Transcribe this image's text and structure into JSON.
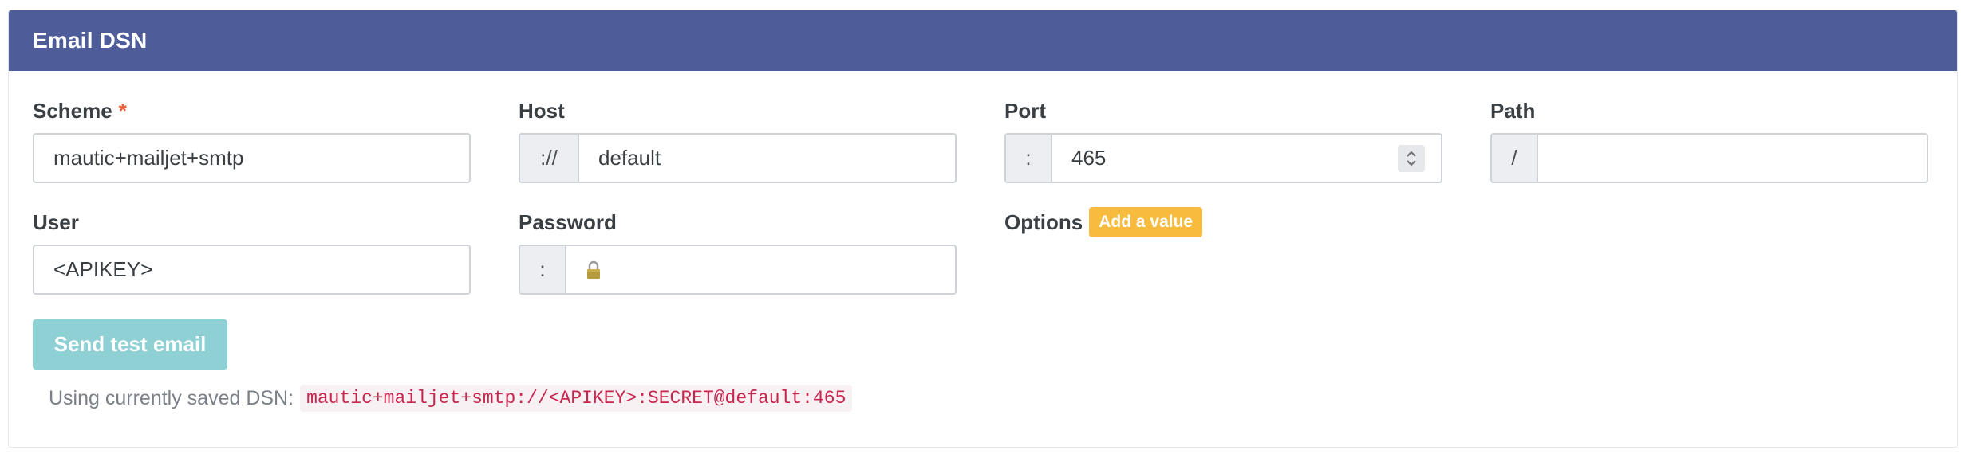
{
  "panel": {
    "title": "Email DSN"
  },
  "fields": {
    "scheme": {
      "label": "Scheme",
      "required_mark": "*",
      "value": "mautic+mailjet+smtp"
    },
    "host": {
      "label": "Host",
      "prefix": "://",
      "value": "default"
    },
    "port": {
      "label": "Port",
      "prefix": ":",
      "value": "465"
    },
    "path": {
      "label": "Path",
      "prefix": "/",
      "value": ""
    },
    "user": {
      "label": "User",
      "value": "<APIKEY>"
    },
    "password": {
      "label": "Password",
      "prefix": ":",
      "icon": "lock-icon"
    },
    "options": {
      "label": "Options",
      "add_button": "Add a value"
    }
  },
  "actions": {
    "send_test": "Send test email"
  },
  "dsn": {
    "prefix_text": "Using currently saved DSN:",
    "value": "mautic+mailjet+smtp://<APIKEY>:SECRET@default:465"
  },
  "colors": {
    "header": "#4e5d9a",
    "required": "#e8603c",
    "badge": "#f7bb3e",
    "button": "#8ed0d4",
    "code": "#c7254e"
  }
}
